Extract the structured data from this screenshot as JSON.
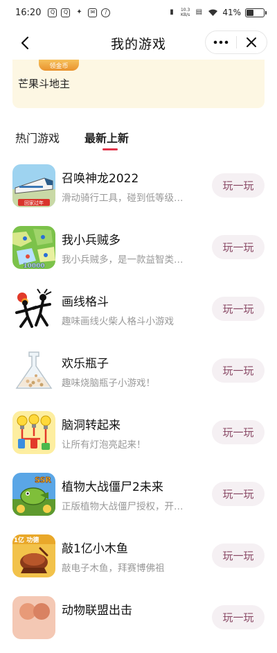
{
  "status_bar": {
    "time": "16:20",
    "left_icons": [
      "q-app-icon",
      "q-app-icon",
      "video-app-icon",
      "mail-icon",
      "app-icon"
    ],
    "net_speed_top": "10.3",
    "net_speed_bottom": "KB/s",
    "battery_percent": "41%",
    "battery_level": 0.41
  },
  "nav": {
    "title": "我的游戏",
    "more_icon": "more-dots-icon",
    "close_icon": "close-icon"
  },
  "promo": {
    "badge": "领金币",
    "game_name": "芒果斗地主",
    "background": "#fdf7e3"
  },
  "tabs": [
    {
      "label": "热门游戏",
      "active": false
    },
    {
      "label": "最新上新",
      "active": true
    }
  ],
  "accent_color": "#e2344a",
  "games": [
    {
      "title": "召唤神龙2022",
      "desc": "滑动骑行工具，碰到低等级…",
      "button": "玩一玩",
      "icon": "train-game-icon",
      "icon_label": "回家过年"
    },
    {
      "title": "我小兵贼多",
      "desc": "我小兵贼多，是一款益智类…",
      "button": "玩一玩",
      "icon": "soldiers-map-game-icon",
      "icon_label": "10000"
    },
    {
      "title": "画线格斗",
      "desc": "趣味画线火柴人格斗小游戏",
      "button": "玩一玩",
      "icon": "stickman-fight-game-icon"
    },
    {
      "title": "欢乐瓶子",
      "desc": "趣味烧脑瓶子小游戏！",
      "button": "玩一玩",
      "icon": "flask-game-icon"
    },
    {
      "title": "脑洞转起来",
      "desc": "让所有灯泡亮起来！",
      "button": "玩一玩",
      "icon": "lightbulb-game-icon"
    },
    {
      "title": "植物大战僵尸2未来",
      "desc": "正版植物大战僵尸授权，开…",
      "button": "玩一玩",
      "icon": "pvz-game-icon",
      "icon_label": "SSR"
    },
    {
      "title": "敲1亿小木鱼",
      "desc": "敲电子木鱼，拜赛博佛祖",
      "button": "玩一玩",
      "icon": "wooden-fish-game-icon",
      "icon_label": "1亿 功德"
    },
    {
      "title": "动物联盟出击",
      "desc": "",
      "button": "玩一玩",
      "icon": "animal-game-icon"
    }
  ]
}
